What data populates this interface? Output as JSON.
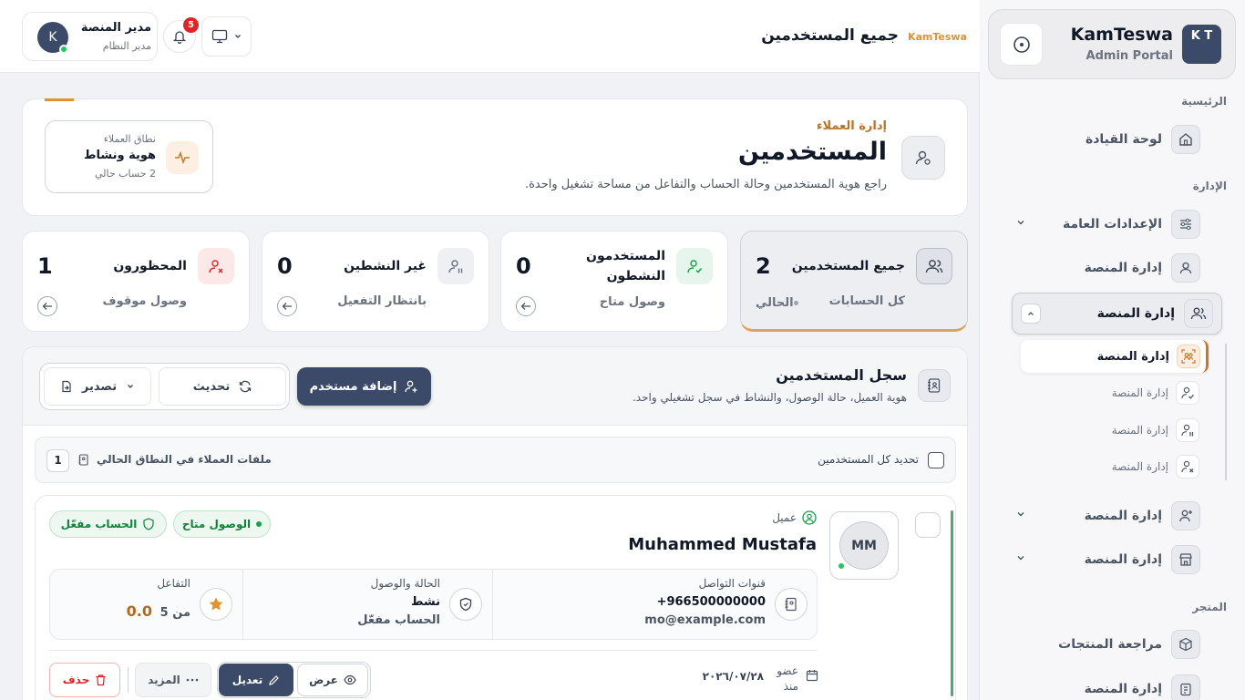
{
  "colors": {
    "brand": "#3b4a68",
    "accent": "#e0932e",
    "success": "#15803d",
    "danger": "#dc2626"
  },
  "sidebar": {
    "brand": {
      "logo": "K T",
      "name": "KamTeswa",
      "subtitle": "Admin Portal"
    },
    "sections": {
      "main": "الرئيسية",
      "admin": "الإدارة",
      "store": "المتجر"
    },
    "items": [
      {
        "label": "لوحة القيادة",
        "icon": "home-icon"
      },
      {
        "label": "الإعدادات العامة",
        "icon": "sliders-icon"
      },
      {
        "label": "إدارة المنصة",
        "icon": "user-icon"
      },
      {
        "label": "إدارة المنصة",
        "icon": "users-icon"
      },
      {
        "label": "إدارة المنصة",
        "icon": "user-plus-icon"
      },
      {
        "label": "إدارة المنصة",
        "icon": "store-icon"
      },
      {
        "label": "مراجعة المنتجات",
        "icon": "box-icon"
      },
      {
        "label": "إدارة المنصة",
        "icon": "clipboard-icon"
      }
    ],
    "subitems": [
      {
        "label": "إدارة المنصة",
        "icon": "users-scan-icon"
      },
      {
        "label": "إدارة المنصة",
        "icon": "user-check-icon"
      },
      {
        "label": "إدارة المنصة",
        "icon": "user-pause-icon"
      },
      {
        "label": "إدارة المنصة",
        "icon": "user-x-icon"
      }
    ]
  },
  "header": {
    "title": "جميع المستخدمين",
    "brand": "KamTeswa",
    "user": {
      "initial": "K",
      "name": "مدير المنصة",
      "role": "مدير النظام"
    },
    "notifications": "5"
  },
  "hero": {
    "kicker": "إدارة العملاء",
    "title": "المستخدمين",
    "description": "راجع هوية المستخدمين وحالة الحساب والتفاعل من مساحة تشغيل واحدة.",
    "scope": {
      "label": "نطاق العملاء",
      "value": "هوية ونشاط",
      "sub": "2 حساب حالي"
    }
  },
  "stats": [
    {
      "title": "جميع المستخدمين",
      "value": "2",
      "sub": "كل الحسابات",
      "current": "الحالي"
    },
    {
      "title": "المستخدمون النشطون",
      "value": "0",
      "sub": "وصول متاح"
    },
    {
      "title": "غير النشطين",
      "value": "0",
      "sub": "بانتظار التفعيل"
    },
    {
      "title": "المحظورون",
      "value": "1",
      "sub": "وصول موقوف"
    }
  ],
  "registry": {
    "title": "سجل المستخدمين",
    "description": "هوية العميل، حالة الوصول، والنشاط في سجل تشغيلي واحد.",
    "add_label": "إضافة مستخدم",
    "refresh_label": "تحديث",
    "export_label": "تصدير",
    "select_all": "تحديد كل المستخدمين",
    "scope_info": "ملفات العملاء في النطاق الحالي",
    "count": "1"
  },
  "user": {
    "initials": "MM",
    "role": "عميل",
    "name": "Muhammed Mustafa",
    "badges": {
      "access": "الوصول متاح",
      "account": "الحساب مفعّل"
    },
    "contact": {
      "label": "قنوات التواصل",
      "phone": "+966500000000",
      "email": "mo@example.com"
    },
    "status": {
      "label": "الحالة والوصول",
      "value": "نشط",
      "sub": "الحساب مفعّل"
    },
    "engagement": {
      "label": "التفاعل",
      "value": "0.0",
      "sub": "من 5"
    },
    "member_since": {
      "label": "عضو منذ",
      "date": "٢٠٢٦/٠٧/٢٨"
    },
    "actions": {
      "view": "عرض",
      "edit": "تعديل",
      "more": "المزيد",
      "delete": "حذف"
    }
  }
}
